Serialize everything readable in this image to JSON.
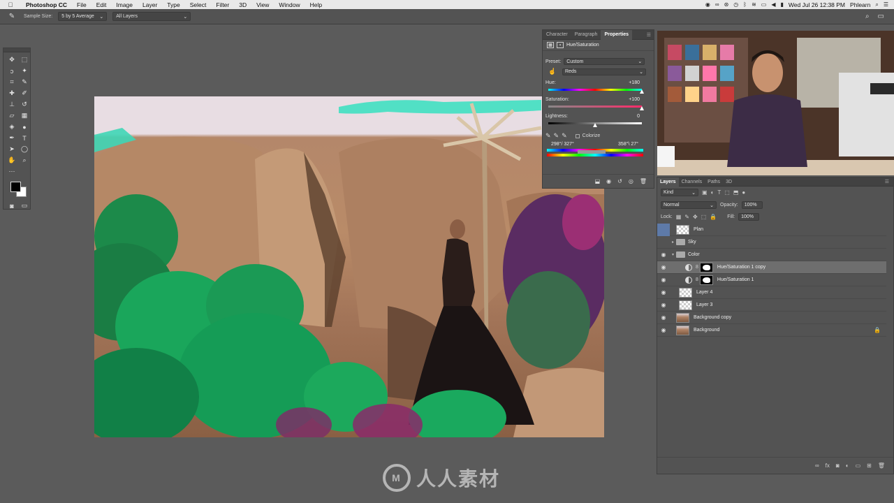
{
  "menubar": {
    "app_name": "Photoshop CC",
    "items": [
      "File",
      "Edit",
      "Image",
      "Layer",
      "Type",
      "Select",
      "Filter",
      "3D",
      "View",
      "Window",
      "Help"
    ],
    "clock": "Wed Jul 26  12:38 PM",
    "user": "Phlearn"
  },
  "options": {
    "sample_size_label": "Sample Size:",
    "sample_size_value": "5 by 5 Average",
    "sample_layers_value": "All Layers"
  },
  "properties": {
    "tabs": [
      "Character",
      "Paragraph",
      "Properties"
    ],
    "active_tab": "Properties",
    "adjustment_title": "Hue/Saturation",
    "preset_label": "Preset:",
    "preset_value": "Custom",
    "channel_value": "Reds",
    "hue_label": "Hue:",
    "hue_value": "+180",
    "saturation_label": "Saturation:",
    "saturation_value": "+100",
    "lightness_label": "Lightness:",
    "lightness_value": "0",
    "colorize_label": "Colorize",
    "range_left": "298°/ 327°",
    "range_right": "358°\\ 27°",
    "hue_level": 1.0,
    "saturation_level": 1.0,
    "lightness_level": 0.5
  },
  "layers": {
    "tabs": [
      "Layers",
      "Channels",
      "Paths",
      "3D"
    ],
    "active_tab": "Layers",
    "filter_kind": "Kind",
    "blend_mode": "Normal",
    "opacity_label": "Opacity:",
    "opacity_value": "100%",
    "lock_label": "Lock:",
    "fill_label": "Fill:",
    "fill_value": "100%",
    "rows": [
      {
        "name": "Plan",
        "type": "layer",
        "visible": false
      },
      {
        "name": "Sky",
        "type": "group",
        "visible": false
      },
      {
        "name": "Color",
        "type": "group",
        "visible": true
      },
      {
        "name": "Hue/Saturation 1 copy",
        "type": "adjustment",
        "visible": true,
        "selected": true
      },
      {
        "name": "Hue/Saturation 1",
        "type": "adjustment",
        "visible": true
      },
      {
        "name": "Layer 4",
        "type": "layer",
        "visible": true
      },
      {
        "name": "Layer 3",
        "type": "layer",
        "visible": true
      },
      {
        "name": "Background copy",
        "type": "photo",
        "visible": true
      },
      {
        "name": "Background",
        "type": "photo",
        "visible": true,
        "locked": true
      }
    ]
  },
  "watermark": {
    "text": "人人素材"
  },
  "colors": {
    "panel_bg": "#535353",
    "workspace_bg": "#5b5b5b",
    "selected_row": "#6e6e6e"
  }
}
